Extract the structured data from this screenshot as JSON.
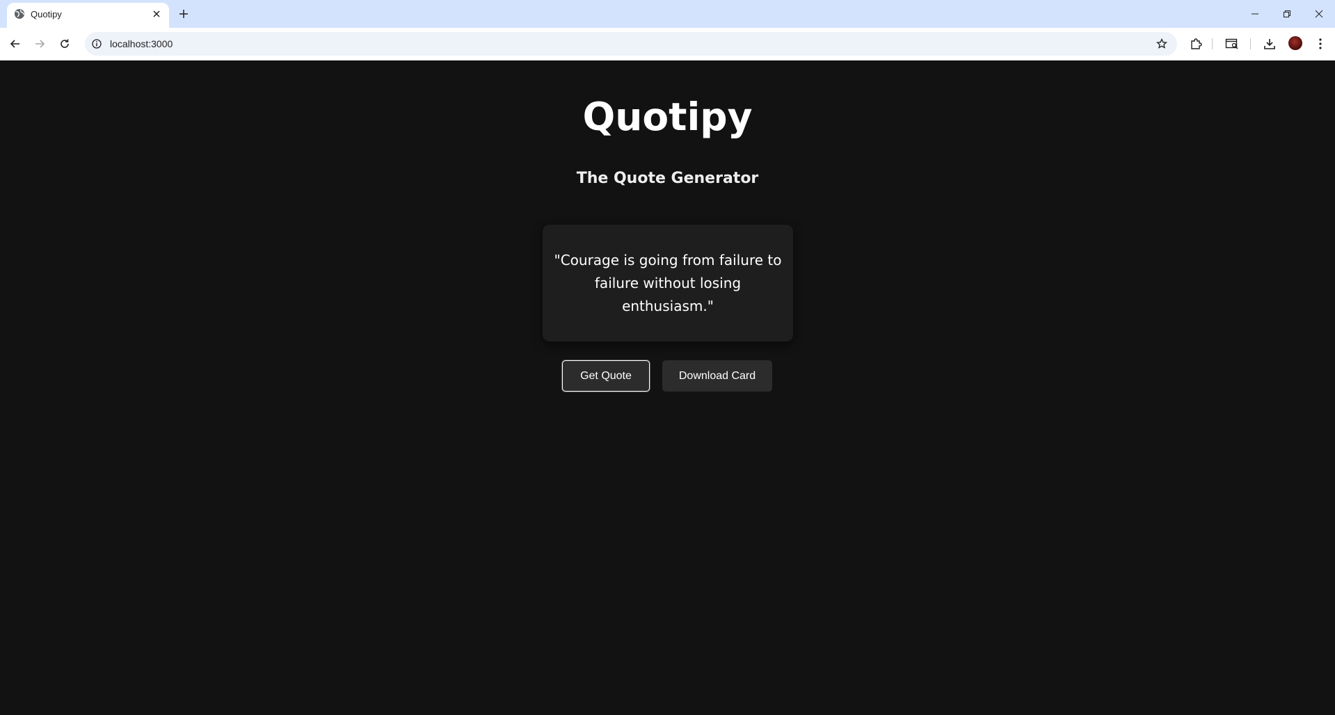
{
  "browser": {
    "tab_title": "Quotipy",
    "url": "localhost:3000"
  },
  "page": {
    "title": "Quotipy",
    "subtitle": "The Quote Generator",
    "quote": "\"Courage is going from failure to failure without losing enthusiasm.\"",
    "buttons": {
      "get_quote": "Get Quote",
      "download_card": "Download Card"
    }
  },
  "colors": {
    "page_background": "#121212",
    "card_background": "#1e1e1e",
    "button_background": "#2c2c2c",
    "titlebar": "#d3e3fd"
  }
}
